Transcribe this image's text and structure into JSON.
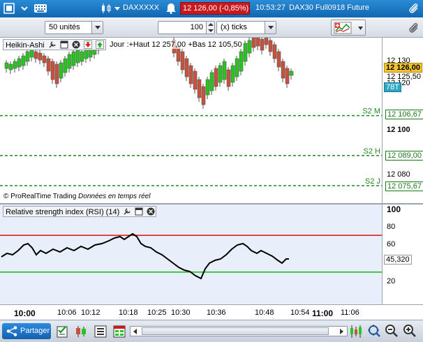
{
  "topbar": {
    "instrument": "DAXXXXX",
    "price_badge": "12 126,00 (-0,85%)",
    "time": "10:53:27",
    "contract": "DAX30 Full0918 Future"
  },
  "toolbar": {
    "units_select": "50 unités",
    "ticks_value": "100",
    "ticks_unit_select": "(x) ticks"
  },
  "price_chart": {
    "header": "Heikin-Ashi",
    "info": "Jour :+Haut 12 257,00 +Bas 12 105,50",
    "credit": "© ProRealTime Trading",
    "realtime": "Données en temps réel",
    "levels": [
      {
        "label": "S2 M",
        "price": 12106.67,
        "tag": "12 106,67"
      },
      {
        "label": "S2 H",
        "price": 12089.0,
        "tag": "12 089,00"
      },
      {
        "label": "S2 J",
        "price": 12075.67,
        "tag": "12 075,67"
      }
    ],
    "axis_ticks": [
      "12 130",
      "12 120",
      "12 100",
      "12 080"
    ],
    "current_price_tag": "12 126,00",
    "last_tag": "12 125,50",
    "countdown_tag": "78T",
    "up_color": "#27c61f",
    "down_color": "#c8503c"
  },
  "rsi_chart": {
    "header": "Relative strength index (RSI) (14)",
    "axis_ticks": [
      "100",
      "80",
      "60",
      "40",
      "20"
    ],
    "value_tag": "45,320",
    "overbought": 70,
    "oversold": 30,
    "overbought_color": "#e02020",
    "oversold_color": "#1fbf1f"
  },
  "time_axis": [
    "10:00",
    "10:06",
    "10:12",
    "10:18",
    "10:25",
    "10:30",
    "10:36",
    "10:48",
    "10:54",
    "11:00",
    "11:06"
  ],
  "bottombar": {
    "share_label": "Partager"
  }
}
